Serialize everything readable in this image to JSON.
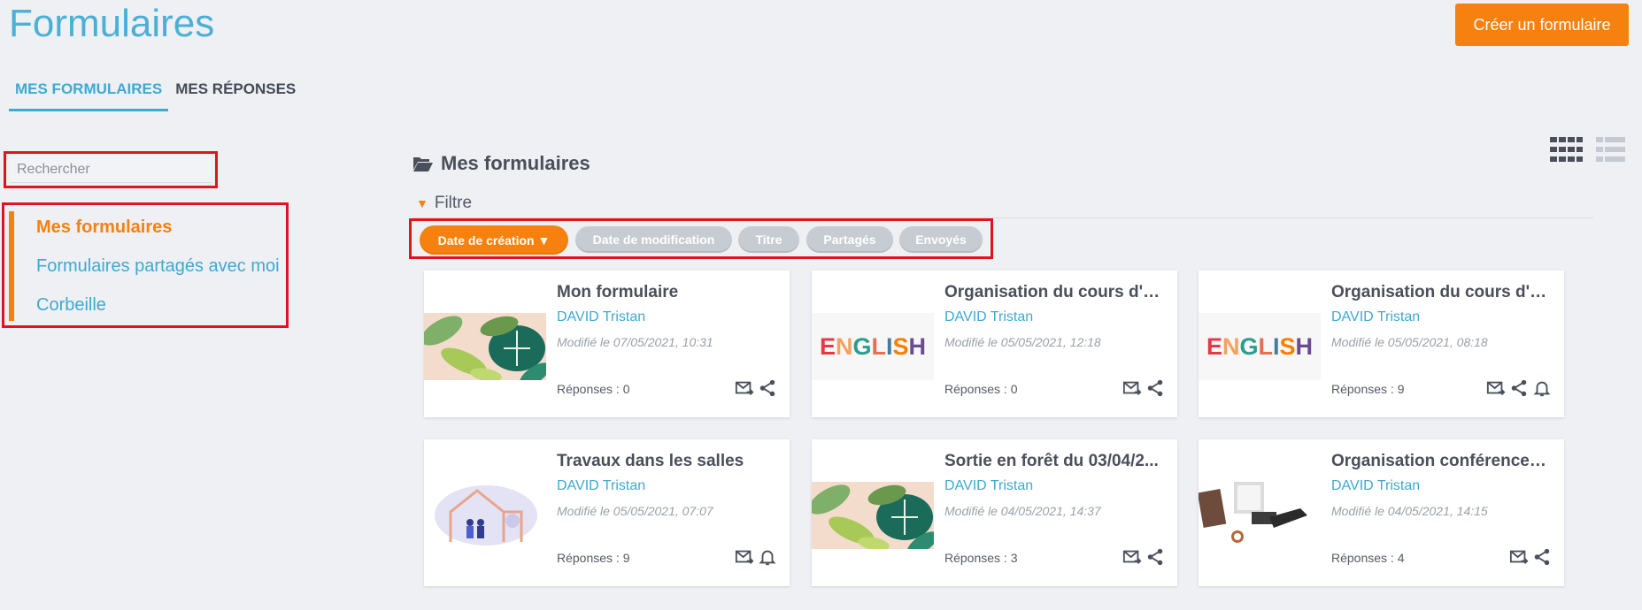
{
  "header": {
    "title": "Formulaires",
    "create_button": "Créer un formulaire"
  },
  "tabs": [
    {
      "label": "MES FORMULAIRES",
      "active": true
    },
    {
      "label": "MES RÉPONSES",
      "active": false
    }
  ],
  "sidebar": {
    "search_placeholder": "Rechercher",
    "items": [
      {
        "label": "Mes formulaires",
        "active": true
      },
      {
        "label": "Formulaires partagés avec moi",
        "active": false
      },
      {
        "label": "Corbeille",
        "active": false
      }
    ]
  },
  "main": {
    "section_title": "Mes formulaires",
    "filter_label": "Filtre",
    "sort_options": [
      {
        "label": "Date de création ▼",
        "active": true
      },
      {
        "label": "Date de modification",
        "active": false
      },
      {
        "label": "Titre",
        "active": false
      },
      {
        "label": "Partagés",
        "active": false
      },
      {
        "label": "Envoyés",
        "active": false
      }
    ]
  },
  "cards": [
    {
      "title": "Mon formulaire",
      "author": "DAVID Tristan",
      "modified": "Modifié le 07/05/2021, 10:31",
      "answers": "Réponses : 0",
      "thumb": "leaves",
      "actions": [
        "mail-icon",
        "share-icon"
      ]
    },
    {
      "title": "Organisation du cours d'a...",
      "author": "DAVID Tristan",
      "modified": "Modifié le 05/05/2021, 12:18",
      "answers": "Réponses : 0",
      "thumb": "english",
      "thumb_text": "ENGLISH",
      "actions": [
        "mail-icon",
        "share-icon"
      ]
    },
    {
      "title": "Organisation du cours d'a...",
      "author": "DAVID Tristan",
      "modified": "Modifié le 05/05/2021, 08:18",
      "answers": "Réponses : 9",
      "thumb": "english",
      "thumb_text": "ENGLISH",
      "actions": [
        "mail-icon",
        "share-icon",
        "bell-icon"
      ]
    },
    {
      "title": "Travaux dans les salles",
      "author": "DAVID Tristan",
      "modified": "Modifié le 05/05/2021, 07:07",
      "answers": "Réponses : 9",
      "thumb": "house",
      "actions": [
        "mail-icon",
        "bell-icon"
      ]
    },
    {
      "title": "Sortie en forêt du 03/04/2...",
      "author": "DAVID Tristan",
      "modified": "Modifié le 04/05/2021, 14:37",
      "answers": "Réponses : 3",
      "thumb": "leaves",
      "actions": [
        "mail-icon",
        "share-icon"
      ]
    },
    {
      "title": "Organisation conférences...",
      "author": "DAVID Tristan",
      "modified": "Modifié le 04/05/2021, 14:15",
      "answers": "Réponses : 4",
      "thumb": "conference",
      "actions": [
        "mail-icon",
        "share-icon"
      ]
    }
  ],
  "colors": {
    "accent": "#f7810f",
    "link": "#3ea9d1",
    "highlight_border": "#e0141f",
    "background": "#eef0f4"
  }
}
